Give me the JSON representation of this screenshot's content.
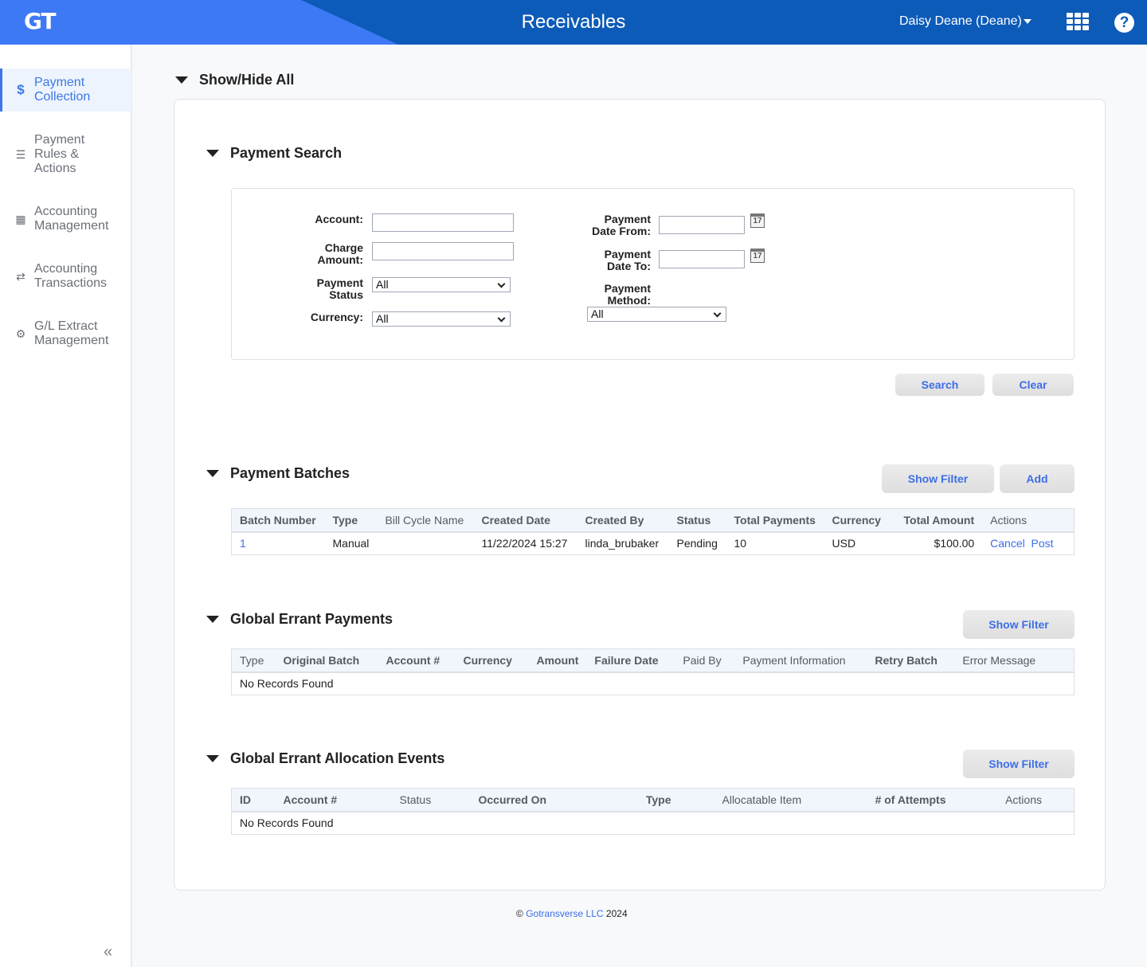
{
  "header": {
    "logo": "GT",
    "title": "Receivables",
    "user": "Daisy Deane (Deane)",
    "apps_icon": "grid-apps-icon",
    "help_icon": "help-circle-icon"
  },
  "sidebar": {
    "items": [
      {
        "label_1": "Payment",
        "label_2": "Collection",
        "icon": "dollar-icon",
        "active": true
      },
      {
        "label_1": "Payment",
        "label_2": "Rules &",
        "label_3": "Actions",
        "icon": "list-icon"
      },
      {
        "label_1": "Accounting",
        "label_2": "Management",
        "icon": "calculator-icon"
      },
      {
        "label_1": "Accounting",
        "label_2": "Transactions",
        "icon": "exchange-icon"
      },
      {
        "label_1": "G/L Extract",
        "label_2": "Management",
        "icon": "gears-icon"
      }
    ],
    "collapse": "«"
  },
  "main": {
    "show_hide_all": "Show/Hide All",
    "payment_search": {
      "title": "Payment Search",
      "fields": {
        "account": {
          "label": "Account:",
          "value": ""
        },
        "charge_amount": {
          "label_1": "Charge",
          "label_2": "Amount:",
          "value": ""
        },
        "payment_status": {
          "label_1": "Payment",
          "label_2": "Status",
          "value": "All"
        },
        "currency": {
          "label": "Currency:",
          "value": "All"
        },
        "date_from": {
          "label_1": "Payment",
          "label_2": "Date From:",
          "value": ""
        },
        "date_to": {
          "label_1": "Payment",
          "label_2": "Date To:",
          "value": ""
        },
        "payment_method": {
          "label_1": "Payment",
          "label_2": "Method:",
          "value": "All"
        }
      },
      "calendar_glyph": "17",
      "search_button": "Search",
      "clear_button": "Clear"
    },
    "payment_batches": {
      "title": "Payment Batches",
      "show_filter": "Show Filter",
      "add": "Add",
      "columns": [
        "Batch Number",
        "Type",
        "Bill Cycle Name",
        "Created Date",
        "Created By",
        "Status",
        "Total Payments",
        "Currency",
        "Total Amount",
        "Actions"
      ],
      "rows": [
        {
          "batch_number": "1",
          "type": "Manual",
          "bill_cycle_name": "",
          "created_date": "11/22/2024 15:27",
          "created_by": "linda_brubaker",
          "status": "Pending",
          "total_payments": "10",
          "currency": "USD",
          "total_amount": "$100.00",
          "action_cancel": "Cancel",
          "action_post": "Post"
        }
      ]
    },
    "global_errant_payments": {
      "title": "Global Errant Payments",
      "show_filter": "Show Filter",
      "columns": [
        "Type",
        "Original Batch",
        "Account #",
        "Currency",
        "Amount",
        "Failure Date",
        "Paid By",
        "Payment Information",
        "Retry Batch",
        "Error Message"
      ],
      "empty": "No Records Found"
    },
    "global_errant_allocation_events": {
      "title": "Global Errant Allocation Events",
      "show_filter": "Show Filter",
      "columns": [
        "ID",
        "Account #",
        "Status",
        "Occurred On",
        "Type",
        "Allocatable Item",
        "# of Attempts",
        "Actions"
      ],
      "empty": "No Records Found"
    }
  },
  "footer": {
    "copyright": "©",
    "company": "Gotransverse LLC",
    "year": "2024"
  },
  "colors": {
    "header_dark": "#0d5bb8",
    "header_light": "#3d79f5",
    "accent": "#3d6ee8"
  }
}
